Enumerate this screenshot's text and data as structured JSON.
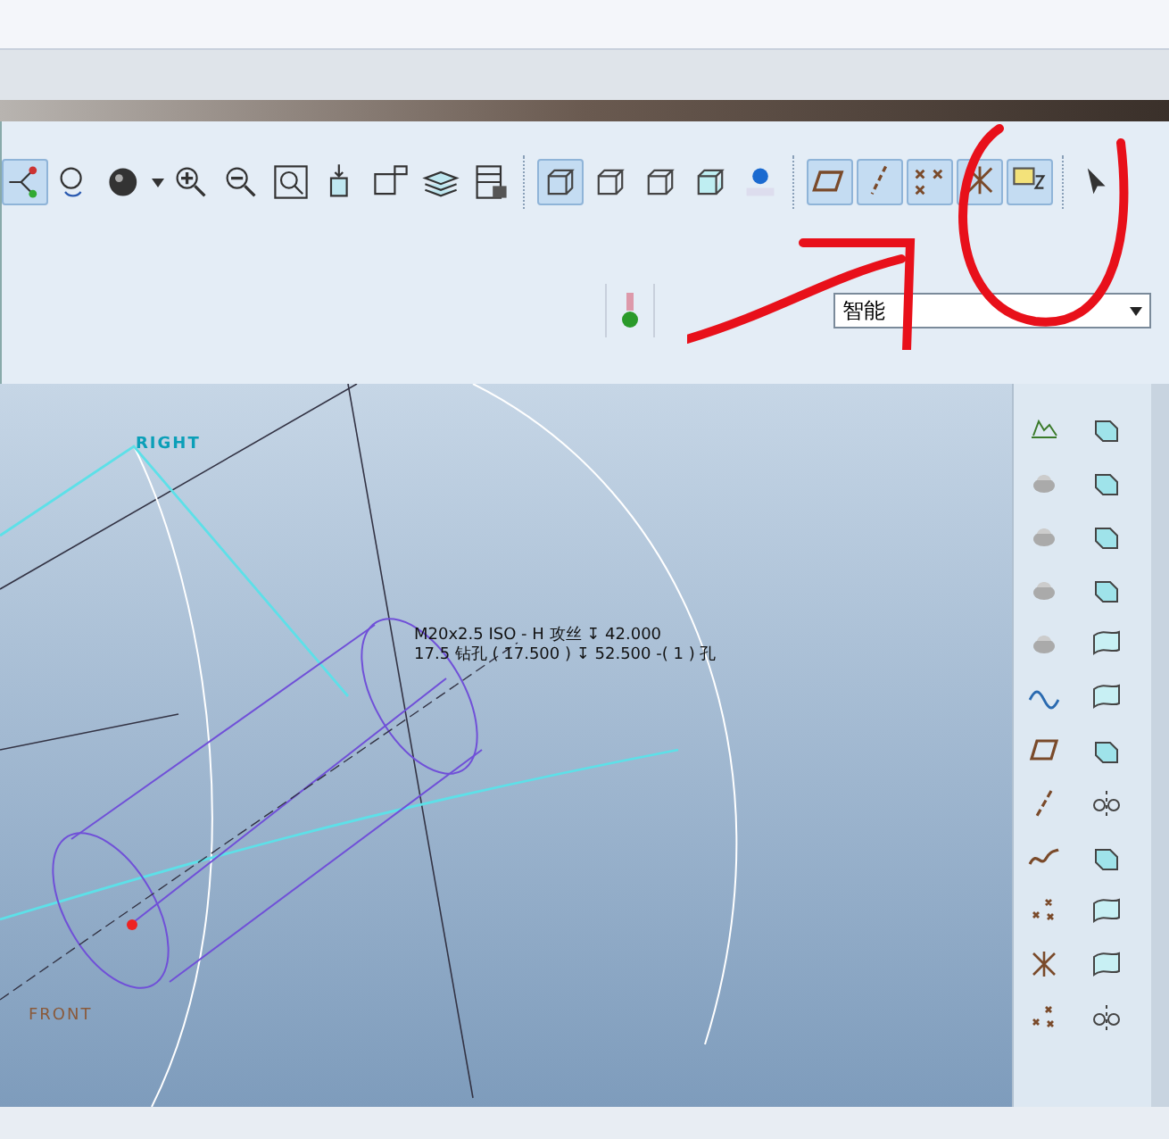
{
  "toolbar": {
    "display_style": [
      {
        "selected": true
      },
      {
        "selected": false
      },
      {
        "selected": false
      },
      {
        "selected": false
      }
    ],
    "datum_display": [
      {
        "on": true
      },
      {
        "on": true
      },
      {
        "on": true
      },
      {
        "on": true
      },
      {
        "on": true
      }
    ]
  },
  "filter": {
    "value": "智能"
  },
  "viewport": {
    "labels": [
      {
        "kind": "datum",
        "text": "RIGHT"
      },
      {
        "kind": "datum",
        "text": "FRONT"
      }
    ],
    "note": [
      "M20x2.5 ISO - H 攻丝 ↧ 42.000",
      "17.5 钻孔 ( 17.500 ) ↧ 52.500  -( 1 ) 孔"
    ]
  }
}
